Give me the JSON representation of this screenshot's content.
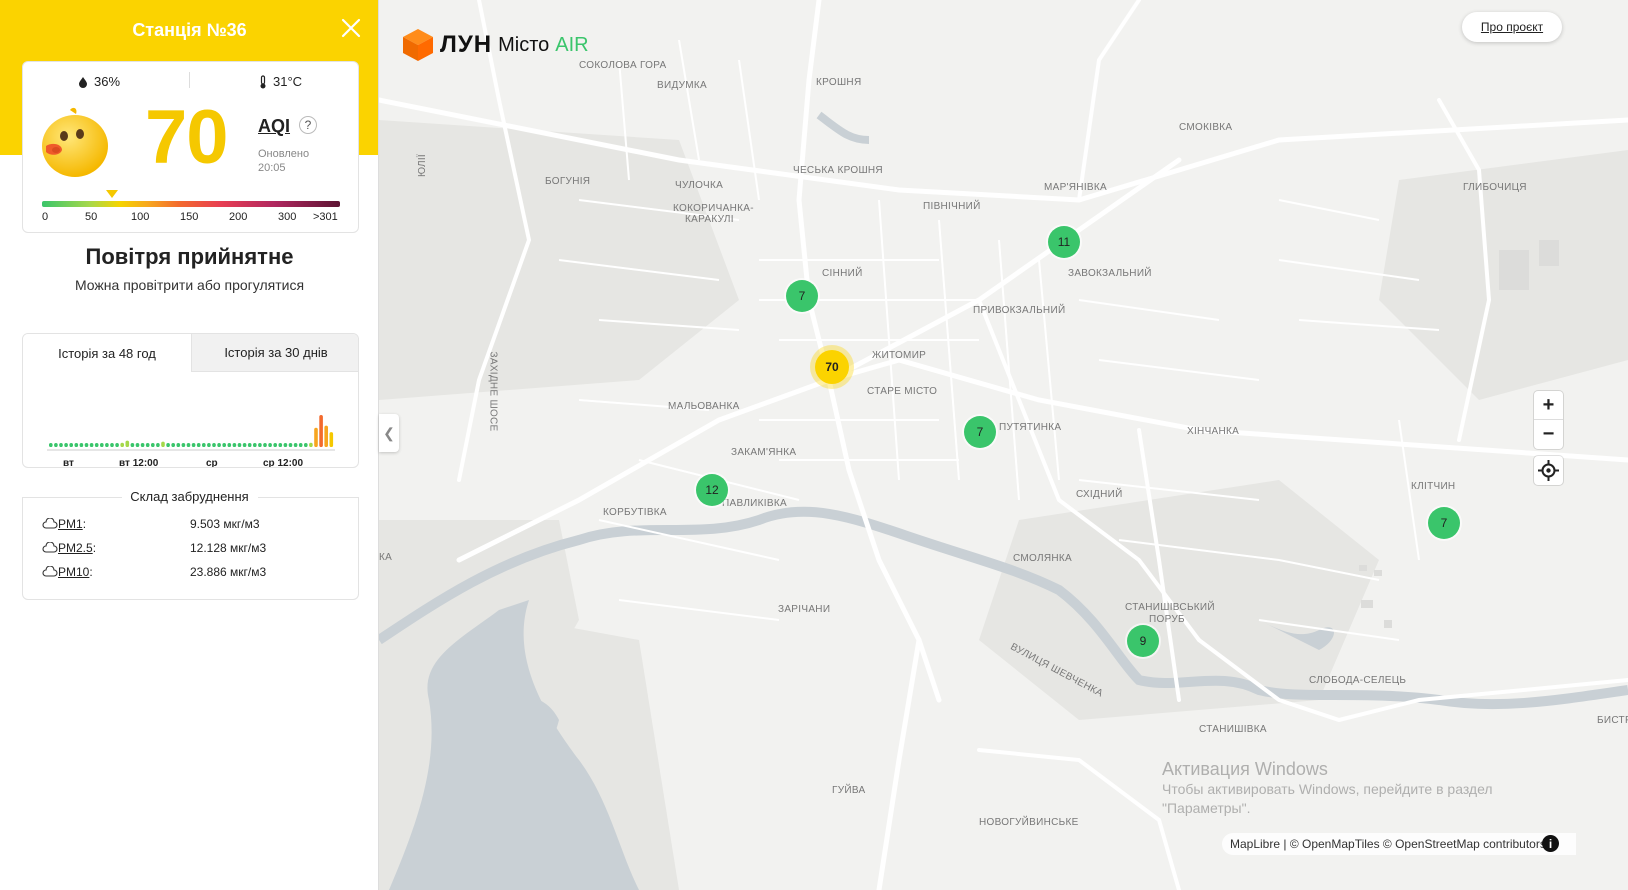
{
  "sidebar": {
    "title": "Станція №36",
    "humidity": "36%",
    "temperature": "31°C",
    "aqi": {
      "value": "70",
      "label": "AQI",
      "help": "?",
      "updated_label": "Оновлено",
      "updated_time": "20:05",
      "level": 70
    },
    "scale": {
      "ticks": [
        "0",
        "50",
        "100",
        "150",
        "200",
        "300",
        ">301"
      ]
    },
    "status_title": "Повітря прийнятне",
    "status_sub": "Можна провітрити або прогулятися",
    "history": {
      "tabs": [
        "Історія за 48 год",
        "Історія за 30 днів"
      ],
      "active_tab": 0,
      "x_labels": [
        "вт",
        "вт 12:00",
        "ср",
        "ср 12:00"
      ],
      "values": [
        3,
        3,
        3,
        3,
        3,
        3,
        3,
        3,
        3,
        3,
        3,
        3,
        3,
        3,
        4,
        6,
        3,
        3,
        3,
        3,
        3,
        3,
        5,
        3,
        3,
        3,
        3,
        3,
        3,
        3,
        3,
        3,
        3,
        3,
        3,
        3,
        3,
        3,
        3,
        3,
        3,
        3,
        3,
        3,
        3,
        3,
        3,
        3,
        3,
        3,
        3,
        4,
        18,
        30,
        20,
        14
      ]
    },
    "composition": {
      "title": "Склад забруднення",
      "items": [
        {
          "name": "PM1",
          "value": "9.503 мкг/м3"
        },
        {
          "name": "PM2.5",
          "value": "12.128 мкг/м3"
        },
        {
          "name": "PM10",
          "value": "23.886 мкг/м3"
        }
      ]
    }
  },
  "map": {
    "logo": {
      "lun": "ЛУН",
      "misto": "Місто",
      "air": "AIR"
    },
    "about_label": "Про проєкт",
    "attribution": "MapLibre | © OpenMapTiles © OpenStreetMap contributors",
    "info": "i",
    "zoom_in": "+",
    "zoom_out": "−",
    "watermark": [
      "Активация Windows",
      "Чтобы активировать Windows, перейдите в раздел",
      "\"Параметры\"."
    ],
    "markers": [
      "70",
      "7",
      "11",
      "7",
      "12",
      "7",
      "9"
    ],
    "labels": [
      "СОКОЛОВА ГОРА",
      "ВИДУМКА",
      "КРОШНЯ",
      "СМОКІВКА",
      "БОГУНІЯ",
      "ЧУЛОЧКА",
      "ЧЕСЬКА КРОШНЯ",
      "КОКОРИЧАНКА-",
      "КАРАКУЛІ",
      "ПІВНІЧНИЙ",
      "МАР'ЯНІВКА",
      "ГЛИБОЧИЦЯ",
      "СІННИЙ",
      "ЗАВОКЗАЛЬНИЙ",
      "ПРИВОКЗАЛЬНИЙ",
      "ЖИТОМИР",
      "СТАРЕ МІСТО",
      "МАЛЬОВАНКА",
      "ПУТЯТИНКА",
      "ХІНЧАНКА",
      "ЗАКАМ'ЯНКА",
      "КЛІТЧИН",
      "СХІДНИЙ",
      "ПАВЛИКІВКА",
      "КОРБУТІВКА",
      "СМОЛЯНКА",
      "ЗАРІЧАНИ",
      "СТАНИШІВСЬКИЙ",
      "ПОРУБ",
      "СЛОБОДА-СЕЛЕЦЬ",
      "СТАНИШІВКА",
      "ГУЙВА",
      "НОВОГУЙВИНСЬКЕ",
      "ВУЛИЦЯ ШЕВЧЕНКА",
      "ЗАХІДНЕ ШОСЕ",
      "ЮЛІЇ",
      "БИСТР",
      "КА"
    ]
  },
  "colors": {
    "accent": "#fbd300",
    "good": "#3ac56b",
    "moderate": "#f5c800"
  }
}
